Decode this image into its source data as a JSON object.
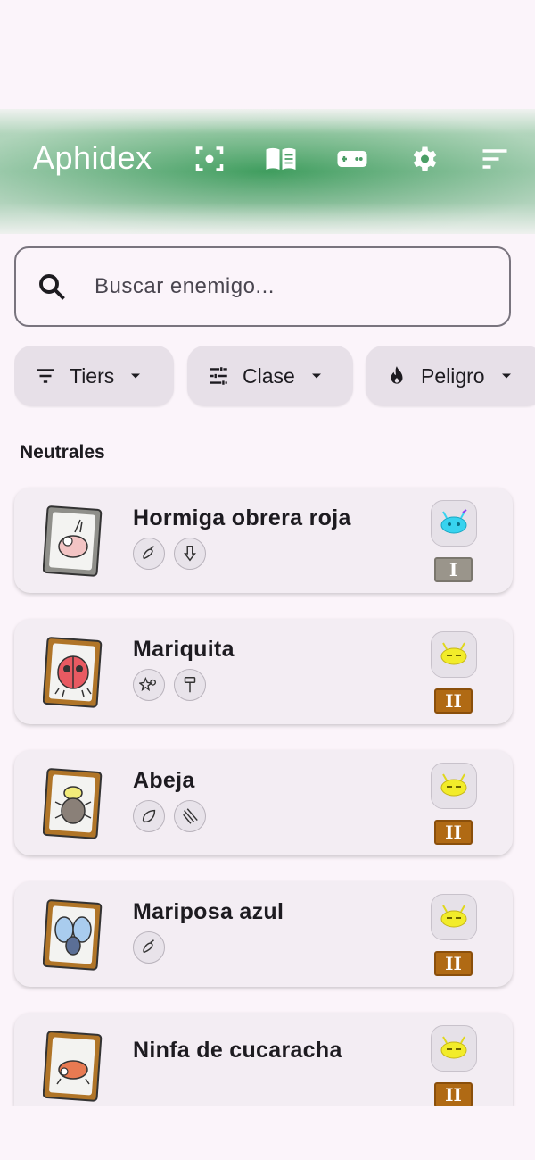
{
  "app": {
    "title": "Aphidex"
  },
  "toolbar_icons": [
    "scan-icon",
    "book-icon",
    "gamepad-icon",
    "settings-icon",
    "sort-icon"
  ],
  "search": {
    "placeholder": "Buscar enemigo..."
  },
  "filters": [
    {
      "label": "Tiers",
      "icon": "filter-list-icon"
    },
    {
      "label": "Clase",
      "icon": "tune-icon"
    },
    {
      "label": "Peligro",
      "icon": "fire-icon"
    }
  ],
  "section": {
    "title": "Neutrales"
  },
  "enemies": [
    {
      "name": "Hormiga obrera roja",
      "tier": "I",
      "danger": "cyan",
      "tags": [
        "claw-icon",
        "down-arrow-icon"
      ]
    },
    {
      "name": "Mariquita",
      "tier": "II",
      "danger": "yellow",
      "tags": [
        "star-burst-icon",
        "hammer-icon"
      ]
    },
    {
      "name": "Abeja",
      "tier": "II",
      "danger": "yellow",
      "tags": [
        "leaf-icon",
        "slash-icon"
      ]
    },
    {
      "name": "Mariposa azul",
      "tier": "II",
      "danger": "yellow",
      "tags": [
        "claw-icon"
      ]
    },
    {
      "name": "Ninfa de cucaracha",
      "tier": "II",
      "danger": "yellow",
      "tags": []
    }
  ],
  "colors": {
    "accent_green": "#3f9d5e",
    "tier_I": "#9a958b",
    "tier_II": "#b06a14"
  }
}
